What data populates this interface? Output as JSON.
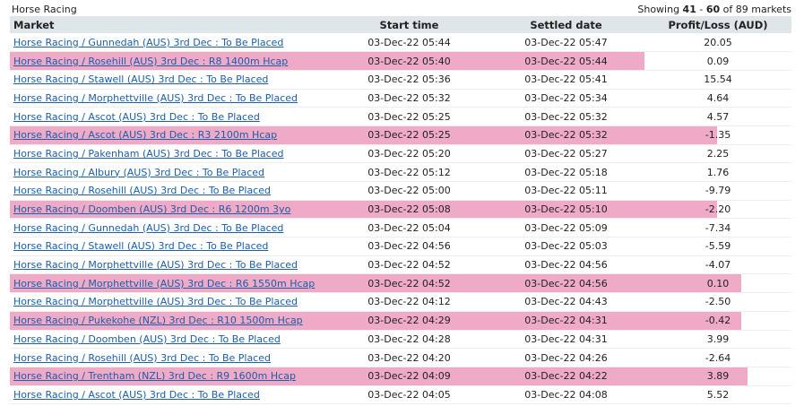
{
  "header": {
    "title": "Horse Racing",
    "showing_prefix": "Showing ",
    "range_start": "41",
    "range_sep": " - ",
    "range_end": "60",
    "total_text": " of 89 markets"
  },
  "table": {
    "columns": {
      "market": "Market",
      "start_time": "Start time",
      "settled_date": "Settled date",
      "profit_loss": "Profit/Loss (AUD)"
    },
    "highlight_color": "#eeaac6",
    "link_color": "#1a5fa8",
    "rows": [
      {
        "market": "Horse Racing / Gunnedah (AUS) 3rd Dec : To Be Placed",
        "start": "03-Dec-22 05:44",
        "settled": "03-Dec-22 05:47",
        "pl": "20.05",
        "highlighted": false
      },
      {
        "market": "Horse Racing / Rosehill (AUS) 3rd Dec : R8 1400m Hcap",
        "start": "03-Dec-22 05:40",
        "settled": "03-Dec-22 05:44",
        "pl": "0.09",
        "highlighted": true
      },
      {
        "market": "Horse Racing / Stawell (AUS) 3rd Dec : To Be Placed",
        "start": "03-Dec-22 05:36",
        "settled": "03-Dec-22 05:41",
        "pl": "15.54",
        "highlighted": false
      },
      {
        "market": "Horse Racing / Morphettville (AUS) 3rd Dec : To Be Placed",
        "start": "03-Dec-22 05:32",
        "settled": "03-Dec-22 05:34",
        "pl": "4.64",
        "highlighted": false
      },
      {
        "market": "Horse Racing / Ascot (AUS) 3rd Dec : To Be Placed",
        "start": "03-Dec-22 05:25",
        "settled": "03-Dec-22 05:32",
        "pl": "4.57",
        "highlighted": false
      },
      {
        "market": "Horse Racing / Ascot (AUS) 3rd Dec : R3 2100m Hcap",
        "start": "03-Dec-22 05:25",
        "settled": "03-Dec-22 05:32",
        "pl": "-1.35",
        "highlighted": true
      },
      {
        "market": "Horse Racing / Pakenham (AUS) 3rd Dec : To Be Placed",
        "start": "03-Dec-22 05:20",
        "settled": "03-Dec-22 05:27",
        "pl": "2.25",
        "highlighted": false
      },
      {
        "market": "Horse Racing / Albury (AUS) 3rd Dec : To Be Placed",
        "start": "03-Dec-22 05:12",
        "settled": "03-Dec-22 05:18",
        "pl": "1.76",
        "highlighted": false
      },
      {
        "market": "Horse Racing / Rosehill (AUS) 3rd Dec : To Be Placed",
        "start": "03-Dec-22 05:00",
        "settled": "03-Dec-22 05:11",
        "pl": "-9.79",
        "highlighted": false
      },
      {
        "market": "Horse Racing / Doomben (AUS) 3rd Dec : R6 1200m 3yo",
        "start": "03-Dec-22 05:08",
        "settled": "03-Dec-22 05:10",
        "pl": "-2.20",
        "highlighted": true
      },
      {
        "market": "Horse Racing / Gunnedah (AUS) 3rd Dec : To Be Placed",
        "start": "03-Dec-22 05:04",
        "settled": "03-Dec-22 05:09",
        "pl": "-7.34",
        "highlighted": false
      },
      {
        "market": "Horse Racing / Stawell (AUS) 3rd Dec : To Be Placed",
        "start": "03-Dec-22 04:56",
        "settled": "03-Dec-22 05:03",
        "pl": "-5.59",
        "highlighted": false
      },
      {
        "market": "Horse Racing / Morphettville (AUS) 3rd Dec : To Be Placed",
        "start": "03-Dec-22 04:52",
        "settled": "03-Dec-22 04:56",
        "pl": "-4.07",
        "highlighted": false
      },
      {
        "market": "Horse Racing / Morphettville (AUS) 3rd Dec : R6 1550m Hcap",
        "start": "03-Dec-22 04:52",
        "settled": "03-Dec-22 04:56",
        "pl": "0.10",
        "highlighted": true
      },
      {
        "market": "Horse Racing / Morphettville (AUS) 3rd Dec : To Be Placed",
        "start": "03-Dec-22 04:12",
        "settled": "03-Dec-22 04:43",
        "pl": "-2.50",
        "highlighted": false
      },
      {
        "market": "Horse Racing / Pukekohe (NZL) 3rd Dec : R10 1500m Hcap",
        "start": "03-Dec-22 04:29",
        "settled": "03-Dec-22 04:31",
        "pl": "-0.42",
        "highlighted": true
      },
      {
        "market": "Horse Racing / Doomben (AUS) 3rd Dec : To Be Placed",
        "start": "03-Dec-22 04:28",
        "settled": "03-Dec-22 04:31",
        "pl": "3.99",
        "highlighted": false
      },
      {
        "market": "Horse Racing / Rosehill (AUS) 3rd Dec : To Be Placed",
        "start": "03-Dec-22 04:20",
        "settled": "03-Dec-22 04:26",
        "pl": "-2.64",
        "highlighted": false
      },
      {
        "market": "Horse Racing / Trentham (NZL) 3rd Dec : R9 1600m Hcap",
        "start": "03-Dec-22 04:09",
        "settled": "03-Dec-22 04:22",
        "pl": "3.89",
        "highlighted": true
      },
      {
        "market": "Horse Racing / Ascot (AUS) 3rd Dec : To Be Placed",
        "start": "03-Dec-22 04:05",
        "settled": "03-Dec-22 04:08",
        "pl": "5.52",
        "highlighted": false
      }
    ]
  }
}
